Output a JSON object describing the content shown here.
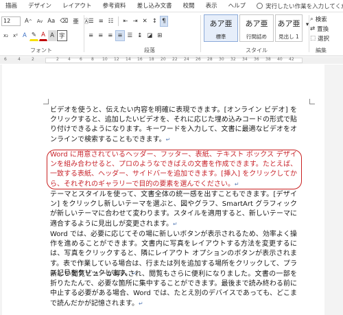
{
  "tabs": [
    "描画",
    "デザイン",
    "レイアウト",
    "参考資料",
    "差し込み文書",
    "校閲",
    "表示",
    "ヘルプ"
  ],
  "tell_me": "実行したい作業を入力してください",
  "font": {
    "size": "12",
    "grow": "A",
    "shrink": "A",
    "case": "Aa",
    "group_label": "フォント"
  },
  "paragraph": {
    "group_label": "段落"
  },
  "styles": {
    "group_label": "スタイル",
    "items": [
      {
        "sample": "あア亜",
        "name": "標準"
      },
      {
        "sample": "あア亜",
        "name": "行間詰め"
      },
      {
        "sample": "あア亜",
        "name": "見出し 1"
      }
    ]
  },
  "editing": {
    "group_label": "編集",
    "find": "検索",
    "replace": "置換",
    "select": "選択"
  },
  "ruler": {
    "left_nums": [
      "6",
      "4",
      "2"
    ],
    "right_nums": [
      "2",
      "4",
      "6",
      "8",
      "10",
      "12",
      "14",
      "16",
      "18",
      "20",
      "22",
      "24",
      "26",
      "28",
      "30",
      "32",
      "34",
      "36",
      "38",
      "40",
      "42"
    ]
  },
  "paragraph_mark": "↵",
  "body": {
    "p1": "ビデオを使うと、伝えたい内容を明確に表現できます。[オンライン ビデオ] をクリックすると、追加したいビデオを、それに応じた埋め込みコードの形式で貼り付けできるようになります。キーワードを入力して、文書に最適なビデオをオンラインで検索することもできます。",
    "p2": "Word に用意されているヘッダー、フッター、表紙、テキスト ボックス デザインを組み合わせると、プロのようなできばえの文書を作成できます。たとえば、一致する表紙、ヘッダー、サイドバーを追加できます。[挿入] をクリックしてから、それぞれのギャラリーで目的の要素を選んでください。",
    "p3": "テーマとスタイルを使って、文書全体の統一感を出すこともできます。[デザイン] をクリックし新しいテーマを選ぶと、図やグラフ、SmartArt グラフィックが新しいテーマに合わせて変わります。スタイルを適用すると、新しいテーマに適合するように見出しが変更されます。",
    "p4": "Word では、必要に応じてその場に新しいボタンが表示されるため、効率よく操作を進めることができます。文書内に写真をレイアウトする方法を変更するには、写真をクリックすると、隣にレイアウト オプションのボタンが表示されます。表で作業している場合は、行または列を追加する場所をクリックして、プラス記号をクリックします。",
    "p5": "新しい閲覧ビューが導入され、閲覧もさらに便利になりました。文書の一部を折りたたんで、必要な箇所に集中することができます。最後まで読み終わる前に中止する必要がある場合、Word では、たとえ別のデバイスであっても、どこまで読んだかが記憶されます。"
  }
}
